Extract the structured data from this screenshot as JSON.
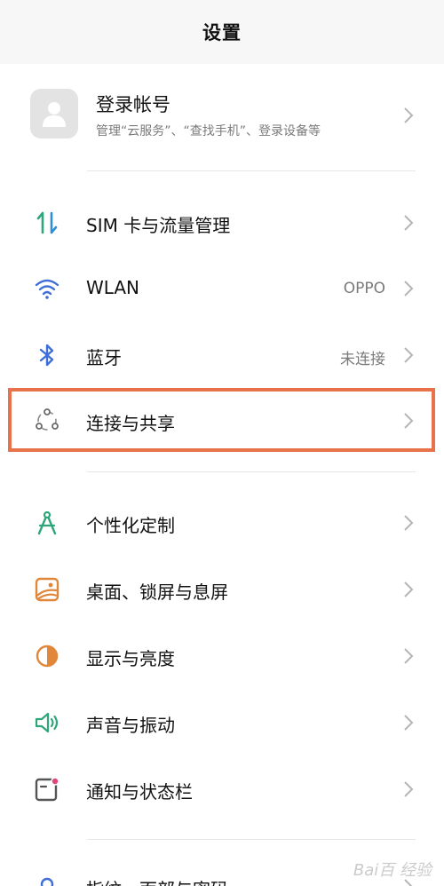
{
  "header": {
    "title": "设置"
  },
  "account": {
    "name": "登录帐号",
    "subtitle": "管理“云服务”、“查找手机”、登录设备等"
  },
  "network": [
    {
      "id": "sim",
      "label": "SIM 卡与流量管理",
      "value": "",
      "icon": "sim-data-icon"
    },
    {
      "id": "wlan",
      "label": "WLAN",
      "value": "OPPO",
      "icon": "wifi-icon"
    },
    {
      "id": "bluetooth",
      "label": "蓝牙",
      "value": "未连接",
      "icon": "bluetooth-icon"
    },
    {
      "id": "connection",
      "label": "连接与共享",
      "value": "",
      "icon": "connection-share-icon"
    }
  ],
  "personal": [
    {
      "id": "personalize",
      "label": "个性化定制",
      "icon": "compass-icon"
    },
    {
      "id": "wallpaper",
      "label": "桌面、锁屏与息屏",
      "icon": "wallpaper-icon"
    },
    {
      "id": "display",
      "label": "显示与亮度",
      "icon": "brightness-icon"
    },
    {
      "id": "sound",
      "label": "声音与振动",
      "icon": "speaker-icon"
    },
    {
      "id": "notification",
      "label": "通知与状态栏",
      "icon": "notification-icon"
    },
    {
      "id": "fingerprint",
      "label": "指纹、面部与密码",
      "icon": "fingerprint-icon"
    }
  ],
  "colors": {
    "highlight": "#e8734a",
    "green": "#2fa67a",
    "blue": "#3f6fd6",
    "orange": "#e0873a"
  },
  "watermark": "Bai百 经验"
}
